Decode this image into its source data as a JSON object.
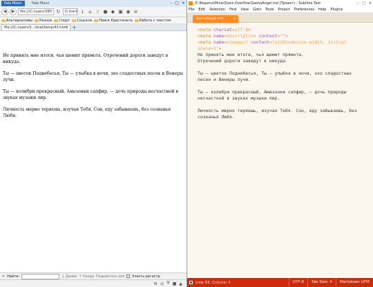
{
  "browser": {
    "app_button": "Pale Moon",
    "second_tab_title": "Pale Moon",
    "window_controls": [
      "–",
      "□",
      "✕"
    ],
    "url": "file:///C:/users/380",
    "search_value": "mark",
    "bookmarks": [
      "Альтернативы",
      "Разное",
      "Спорт",
      "Соцсети",
      "Поиск Кристинета",
      "Работа с текстом"
    ],
    "tab_title": "file:///C:/users/3...local/temp/43.html",
    "paragraphs": [
      "Не принять мне итоги, чья щемит прямота. Отречений дороги заведут в никуда.",
      "Ты — цветок Поднебесья, Ты — улыбка в ночи, эхо сладостных песен и Венеры лучи.",
      "Ты — колибри прекрасный, Амазонки сапфир, — дочь природы несчастной в звуках музыки лир.",
      "Личность мерно теряешь, изучая Тебя. Сон, еду забываешь, без сознанья Любя."
    ],
    "findbar": {
      "label": "Найти:",
      "next": "Далее",
      "prev": "Назад",
      "highlight": "Подсветить все",
      "match_case": "Учесть регистр"
    }
  },
  "sublime": {
    "title": "E:\\Кирилл\\Mine\\Stack Overflow\\SashaAngel.md (Проект) - Sublime Text",
    "window_controls": [
      "–",
      "□",
      "✕"
    ],
    "menu": [
      "File",
      "Edit",
      "Selection",
      "Find",
      "View",
      "Goto",
      "Tools",
      "Project",
      "Preferences",
      "Help",
      "Plugins"
    ],
    "tab": "SashaAngel.md",
    "code": {
      "meta1": {
        "open": "<meta ",
        "attr": "charset",
        "eq": "=",
        "val": "utf-8",
        "close": ">"
      },
      "meta2": {
        "open": "<meta ",
        "attr1": "name",
        "val1": "description",
        "attr2": " content",
        "val2": "\"\"",
        "close": ">"
      },
      "meta3": {
        "open": "<meta ",
        "attr1": "name",
        "val1": "viewport",
        "attr2": " content",
        "val2": "\"width=device-width, initial-scale=1\"",
        "close": ">"
      }
    },
    "lines": [
      "Не принять мне итоги, чья щемит прямота.",
      "Отречений дороги заведут в никуда.",
      "Ты — цветок Поднебесья, Ты — улыбка в ночи, эхо сладостных песен и Венеры лучи.",
      "Ты — колибри прекрасный, Амазонки сапфир, — дочь природы несчастной в звуках музыки лир.",
      "Личность мерно теряешь, изучая Тебя. Сон, еду забываешь, без сознанья Любя."
    ],
    "status": {
      "position": "Line 33, Column 1",
      "encoding": "UTF-8",
      "tab_size": "Tab Size: 4",
      "syntax": "Markdown GFM"
    },
    "colors": {
      "accent": "#cc2a08",
      "tab": "#ff8a23",
      "background": "#fbf7ef"
    }
  }
}
